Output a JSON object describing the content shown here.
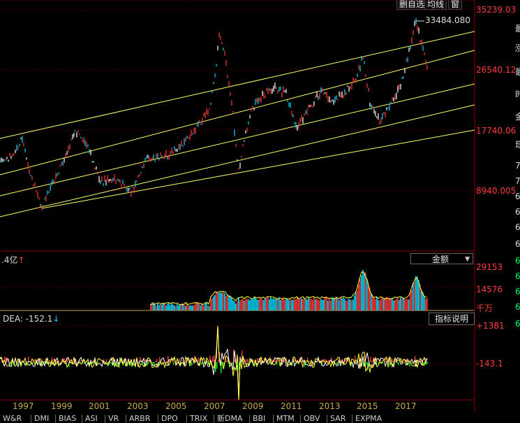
{
  "toolbar": {
    "btn_delete_watch": "删自选",
    "btn_ma": "均线",
    "btn_window": "窗"
  },
  "main_chart": {
    "peak_label": "33484.080",
    "price_axis": [
      "35239.03",
      "26540.12",
      "17740.06",
      "8940.005"
    ]
  },
  "right_strip": [
    "最",
    "涨",
    "最",
    "时",
    "金",
    "现",
    "7",
    "7",
    "6",
    "6",
    "6",
    "6",
    "6",
    "6",
    "6",
    "6",
    "6"
  ],
  "volume_panel": {
    "label": ".4亿",
    "arrow": "↑",
    "selector": "金额",
    "selector_icon": "triangle-down-icon",
    "axis": [
      "29153",
      "14576"
    ],
    "unit": "千万"
  },
  "indicator_panel": {
    "label": "DEA: -152.1",
    "arrow": "↓",
    "button": "指标说明",
    "axis": [
      "+1381",
      "-143.1"
    ]
  },
  "time_axis": [
    "1997",
    "1999",
    "2001",
    "2003",
    "2005",
    "2007",
    "2009",
    "2011",
    "2013",
    "2015",
    "2017"
  ],
  "bottom_tabs": [
    "W&R",
    "DMI",
    "BIAS",
    "ASI",
    "VR",
    "ARBR",
    "DPO",
    "TRIX",
    "新DMA",
    "BBI",
    "MTM",
    "OBV",
    "SAR",
    "EXPMA"
  ],
  "colors": {
    "up": "#ff3b3b",
    "down": "#00ff00",
    "price_line": "#ffffff",
    "channel": "#ffff66",
    "grid": "#5a0000",
    "axis_year": "#c8a84a",
    "cyan": "#00d8ff"
  }
}
